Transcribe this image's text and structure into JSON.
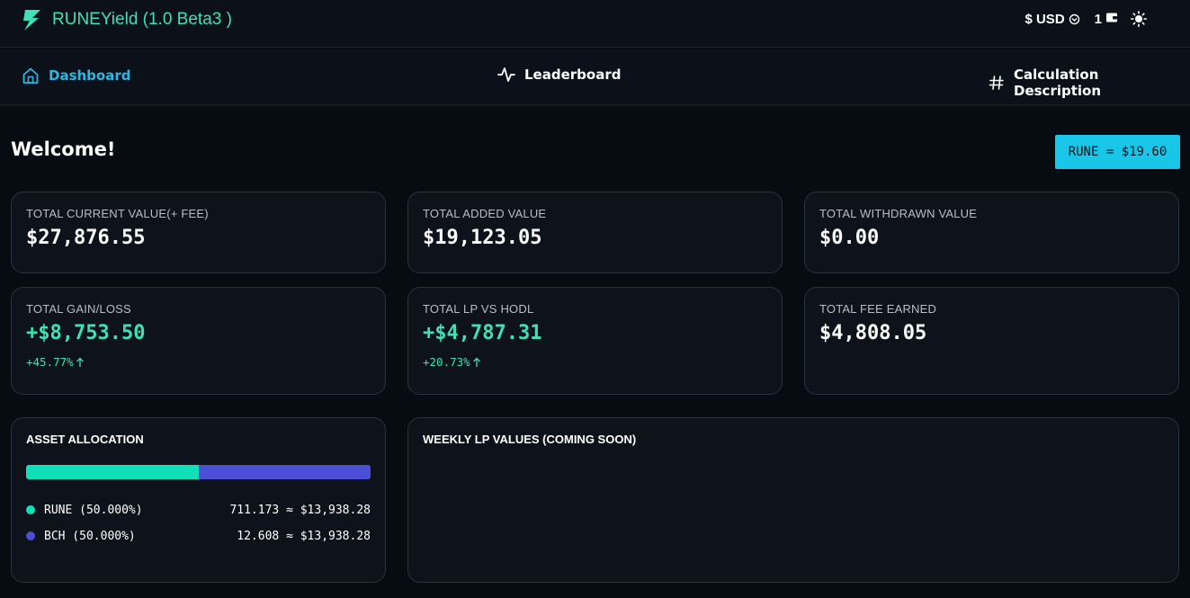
{
  "app": {
    "title": "RUNEYield (1.0 Beta3 )",
    "currency": "$ USD",
    "wallet_count": "1"
  },
  "nav": {
    "items": [
      {
        "label": "Dashboard",
        "icon": "home-icon",
        "active": true
      },
      {
        "label": "Leaderboard",
        "icon": "activity-icon",
        "active": false
      },
      {
        "label": "Calculation Description",
        "icon": "hash-icon",
        "active": false
      }
    ]
  },
  "main": {
    "welcome": "Welcome!",
    "rune_price": "RUNE = $19.60"
  },
  "stats": [
    {
      "label": "TOTAL CURRENT VALUE(+ FEE)",
      "value": "$27,876.55"
    },
    {
      "label": "TOTAL ADDED VALUE",
      "value": "$19,123.05"
    },
    {
      "label": "TOTAL WITHDRAWN VALUE",
      "value": "$0.00"
    },
    {
      "label": "TOTAL GAIN/LOSS",
      "value": "+$8,753.50",
      "change": "+45.77%"
    },
    {
      "label": "TOTAL LP VS HODL",
      "value": "+$4,787.31",
      "change": "+20.73%"
    },
    {
      "label": "TOTAL FEE EARNED",
      "value": "$4,808.05"
    }
  ],
  "allocation": {
    "title": "ASSET ALLOCATION",
    "assets": [
      {
        "name": "RUNE (50.000%)",
        "amount": "711.173 ≈ $13,938.28",
        "share": 0.5,
        "color": "#0fe0b8"
      },
      {
        "name": "BCH (50.000%)",
        "amount": "12.608 ≈ $13,938.28",
        "share": 0.5,
        "color": "#4a4fd6"
      }
    ]
  },
  "weekly": {
    "title": "WEEKLY LP VALUES (COMING SOON)"
  },
  "colors": {
    "accent": "#3fe0b8",
    "nav_active": "#2bb7e6",
    "price_badge": "#18c6e8"
  }
}
